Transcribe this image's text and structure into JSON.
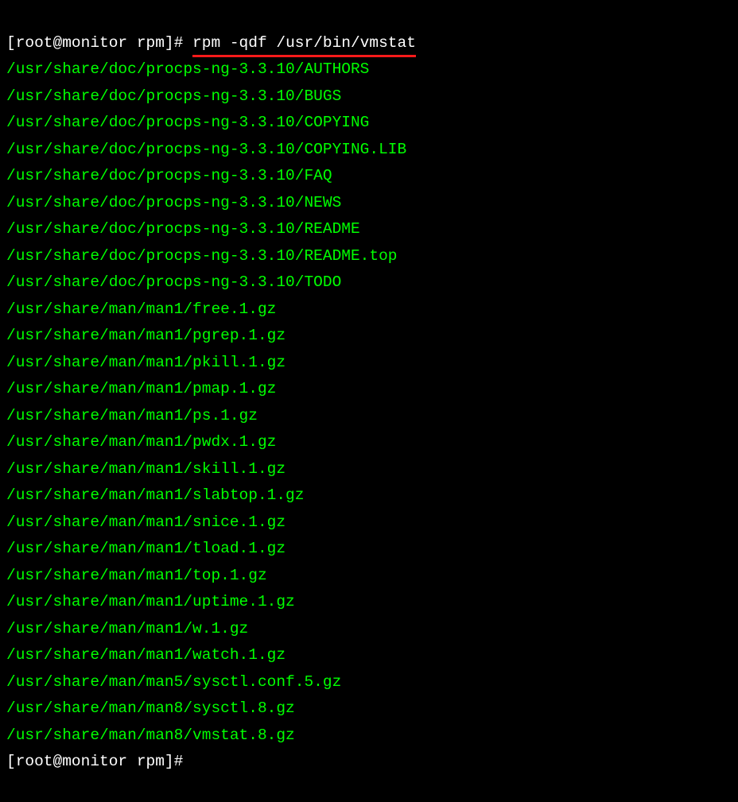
{
  "prompt1": {
    "user_host": "[root@monitor rpm]# ",
    "command": "rpm -qdf /usr/bin/vmstat"
  },
  "output": [
    "/usr/share/doc/procps-ng-3.3.10/AUTHORS",
    "/usr/share/doc/procps-ng-3.3.10/BUGS",
    "/usr/share/doc/procps-ng-3.3.10/COPYING",
    "/usr/share/doc/procps-ng-3.3.10/COPYING.LIB",
    "/usr/share/doc/procps-ng-3.3.10/FAQ",
    "/usr/share/doc/procps-ng-3.3.10/NEWS",
    "/usr/share/doc/procps-ng-3.3.10/README",
    "/usr/share/doc/procps-ng-3.3.10/README.top",
    "/usr/share/doc/procps-ng-3.3.10/TODO",
    "/usr/share/man/man1/free.1.gz",
    "/usr/share/man/man1/pgrep.1.gz",
    "/usr/share/man/man1/pkill.1.gz",
    "/usr/share/man/man1/pmap.1.gz",
    "/usr/share/man/man1/ps.1.gz",
    "/usr/share/man/man1/pwdx.1.gz",
    "/usr/share/man/man1/skill.1.gz",
    "/usr/share/man/man1/slabtop.1.gz",
    "/usr/share/man/man1/snice.1.gz",
    "/usr/share/man/man1/tload.1.gz",
    "/usr/share/man/man1/top.1.gz",
    "/usr/share/man/man1/uptime.1.gz",
    "/usr/share/man/man1/w.1.gz",
    "/usr/share/man/man1/watch.1.gz",
    "/usr/share/man/man5/sysctl.conf.5.gz",
    "/usr/share/man/man8/sysctl.8.gz",
    "/usr/share/man/man8/vmstat.8.gz"
  ],
  "prompt2": {
    "user_host": "[root@monitor rpm]# "
  }
}
